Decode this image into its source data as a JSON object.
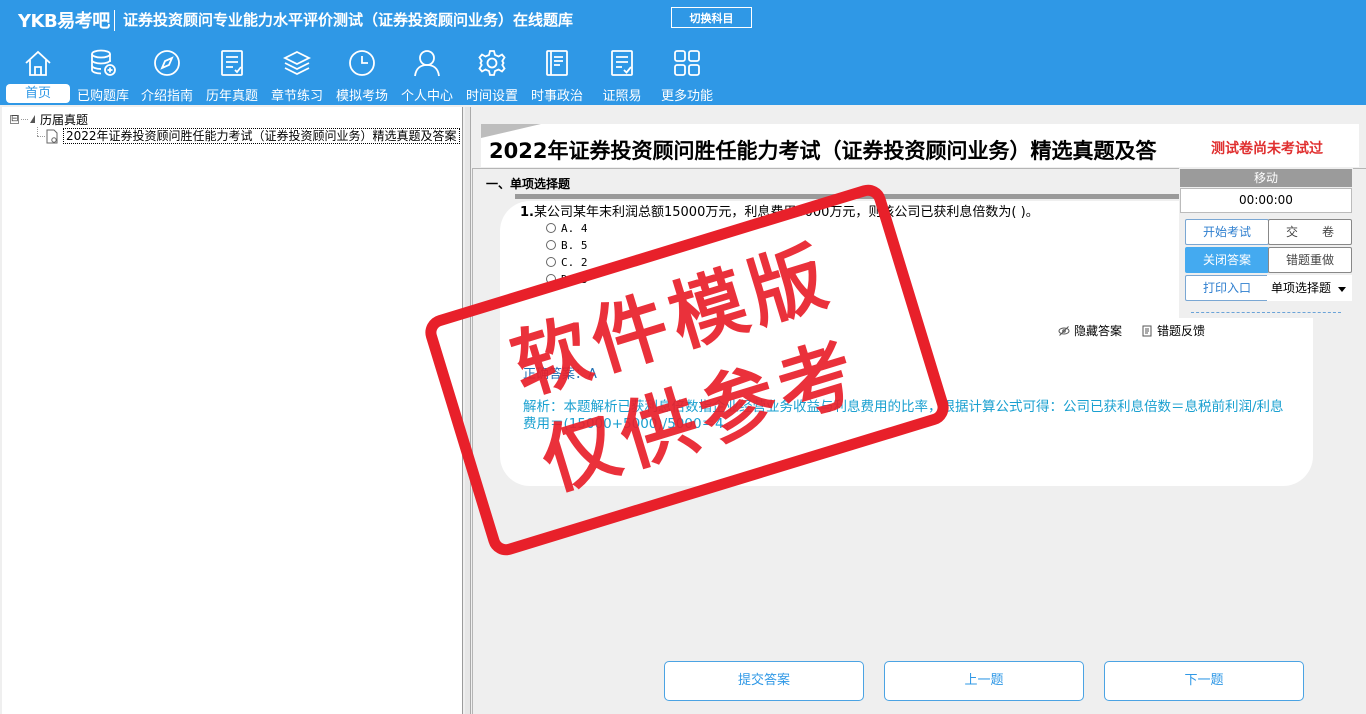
{
  "header": {
    "brand": "YKB易考吧",
    "title": "证券投资顾问专业能力水平评价测试（证券投资顾问业务）在线题库",
    "switch_label": "切换科目"
  },
  "nav": [
    {
      "label": "首页",
      "icon": "home-icon",
      "active": true
    },
    {
      "label": "已购题库",
      "icon": "database-icon"
    },
    {
      "label": "介绍指南",
      "icon": "compass-icon"
    },
    {
      "label": "历年真题",
      "icon": "list-icon"
    },
    {
      "label": "章节练习",
      "icon": "layers-icon"
    },
    {
      "label": "模拟考场",
      "icon": "clock-icon"
    },
    {
      "label": "个人中心",
      "icon": "user-icon"
    },
    {
      "label": "时间设置",
      "icon": "gear-icon"
    },
    {
      "label": "时事政治",
      "icon": "book-icon"
    },
    {
      "label": "证照易",
      "icon": "checklist-icon"
    },
    {
      "label": "更多功能",
      "icon": "grid-icon"
    }
  ],
  "tree": {
    "expander": "⊟",
    "root": "历届真题",
    "child": "2022年证券投资顾问胜任能力考试（证券投资顾问业务）精选真题及答案"
  },
  "paper": {
    "title": "2022年证券投资顾问胜任能力考试（证券投资顾问业务）精选真题及答",
    "status": "测试卷尚未考试过"
  },
  "section": {
    "title": "一、单项选择题"
  },
  "question": {
    "number": "1.",
    "stem": "某公司某年末利润总额15000万元，利息费用5000万元，则该公司已获利息倍数为( )。",
    "options": [
      "A. 4",
      "B. 5",
      "C. 2",
      "D. 3"
    ],
    "answer": "正确答案：A",
    "analysis": "解析：本题解析已获利息倍数指企业经营业务收益与利息费用的比率，根据计算公式可得：公司已获利息倍数＝息税前利润/利息费用＝(15000+5000)/5000＝4。"
  },
  "tools": {
    "hide_answer": "隐藏答案",
    "feedback": "错题反馈"
  },
  "control": {
    "header": "移动",
    "timer": "00:00:00",
    "start": "开始考试",
    "submit_paper": "交　　卷",
    "close_answer": "关闭答案",
    "redo_wrong": "错题重做",
    "print": "打印入口",
    "type_select": "单项选择题"
  },
  "bottom": {
    "submit": "提交答案",
    "prev": "上一题",
    "next": "下一题"
  },
  "watermark": {
    "line1": "软件模版",
    "line2": "仅供参考"
  },
  "colors": {
    "topbar": "#2f98e6",
    "status_red": "#e03030",
    "analysis_blue": "#1aa0d0",
    "stamp_red": "#e8202a"
  }
}
